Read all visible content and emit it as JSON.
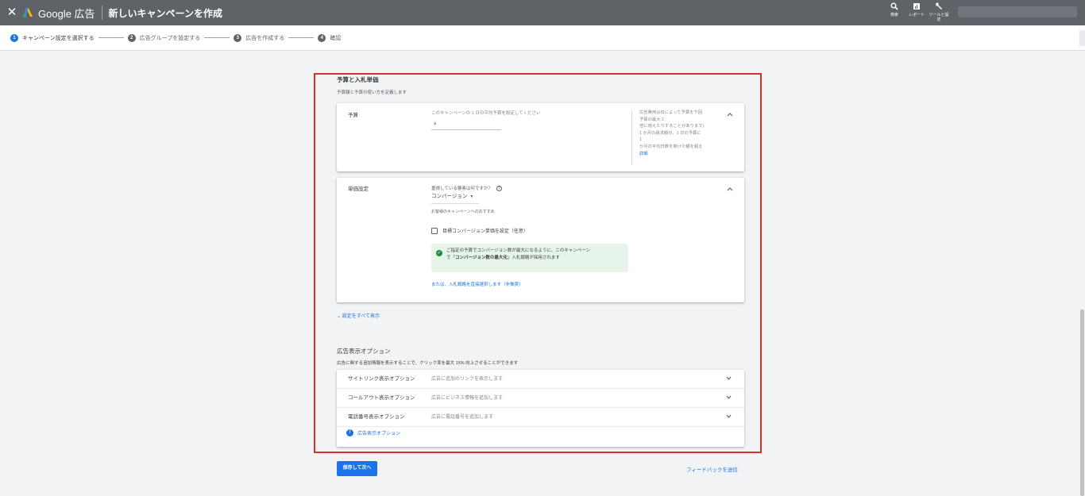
{
  "topbar": {
    "close": "✕",
    "product": "Google 広告",
    "title": "新しいキャンペーンを作成",
    "tools": [
      {
        "label": "検索",
        "icon": "search-icon"
      },
      {
        "label": "レポート",
        "icon": "report-icon"
      },
      {
        "label": "ツールと設定",
        "icon": "wrench-icon"
      }
    ]
  },
  "stepper": {
    "steps": [
      {
        "num": "1",
        "label": "キャンペーン設定を選択する"
      },
      {
        "num": "2",
        "label": "広告グループを設定する"
      },
      {
        "num": "3",
        "label": "広告を作成する"
      },
      {
        "num": "4",
        "label": "確認"
      }
    ]
  },
  "budget_section": {
    "title": "予算と入札単価",
    "subtitle": "予算額と予算の使い方を定義します"
  },
  "budget_card": {
    "label": "予算",
    "hint": "このキャンペーンの 1 日の平均予算を設定してください",
    "currency": "¥",
    "side_lines": [
      "広告費用は日によって予算を下回",
      "予算の最大 2",
      "倍に増えたりすることがあります)",
      "1 か月の請求額が、1 日の予算に",
      "1",
      "か月の平均日数を掛けた額を超え"
    ],
    "side_link": "詳細"
  },
  "bid_card": {
    "label": "単価設定",
    "question": "重視している要素は何ですか？",
    "help": "?",
    "selected": "コンバージョン",
    "recommend": "お客様のキャンペーンへのおすすめ",
    "checkbox_label": "目標コンバージョン単価を設定（任意）",
    "info_line1": "ご指定の予算でコンバージョン数が最大になるように、このキャンペーン",
    "info_prefix": "で「",
    "info_bold": "コンバージョン数の最大化",
    "info_suffix": "」入札戦略が採用されます",
    "alt_link": "または、入札戦略を直接選択します（非推奨）"
  },
  "show_all": "設定をすべて表示",
  "extensions": {
    "title": "広告表示オプション",
    "subtitle": "広告に関する追加情報を表示することで、クリック率を最大 15% 向上させることができます",
    "rows": [
      {
        "name": "サイトリンク表示オプション",
        "desc": "広告に追加のリンクを表示します"
      },
      {
        "name": "コールアウト表示オプション",
        "desc": "広告にビジネス情報を追加します"
      },
      {
        "name": "電話番号表示オプション",
        "desc": "広告に電話番号を追加します"
      }
    ],
    "footer": "広告表示オプション"
  },
  "actions": {
    "save": "保存して次へ",
    "feedback": "フィードバックを送信"
  },
  "colors": {
    "topbar": "#5f6368",
    "accent": "#1a73e8",
    "highlight": "#d93025",
    "success": "#1e8e3e"
  }
}
